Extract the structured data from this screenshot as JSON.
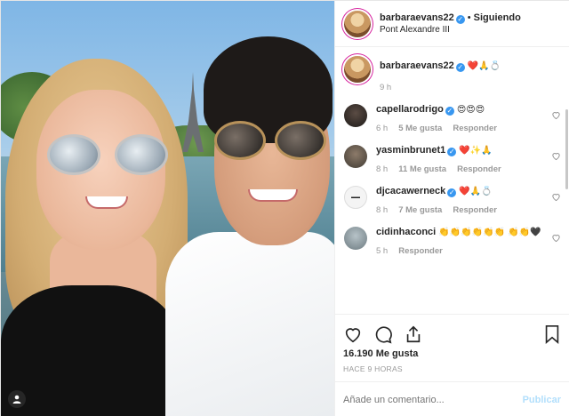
{
  "post": {
    "author": "barbaraevans22",
    "follow_state": "Siguiendo",
    "location": "Pont Alexandre III",
    "caption_emojis": "❤️🙏💍",
    "caption_time": "9 h",
    "likes": "16.190 Me gusta",
    "ago": "HACE 9 HORAS"
  },
  "comments": [
    {
      "user": "capellarodrigo",
      "text": "😍😍😍",
      "time": "6 h",
      "likes": "5 Me gusta",
      "reply": "Responder"
    },
    {
      "user": "yasminbrunet1",
      "text": "❤️✨🙏",
      "time": "8 h",
      "likes": "11 Me gusta",
      "reply": "Responder"
    },
    {
      "user": "djcacawerneck",
      "text": "❤️🙏💍",
      "time": "8 h",
      "likes": "7 Me gusta",
      "reply": "Responder"
    },
    {
      "user": "cidinhaconci",
      "text": "👏👏👏👏👏👏 👏👏🖤",
      "time": "5 h",
      "likes": "",
      "reply": "Responder"
    }
  ],
  "add_comment": {
    "placeholder": "Añade un comentario...",
    "publish": "Publicar"
  },
  "colors": {
    "verified": "#3897f0",
    "publish": "#b2dffc",
    "muted": "#999999"
  },
  "icons": [
    "heart-icon",
    "comment-icon",
    "share-icon",
    "bookmark-icon",
    "verified-icon",
    "user-tag-icon"
  ]
}
